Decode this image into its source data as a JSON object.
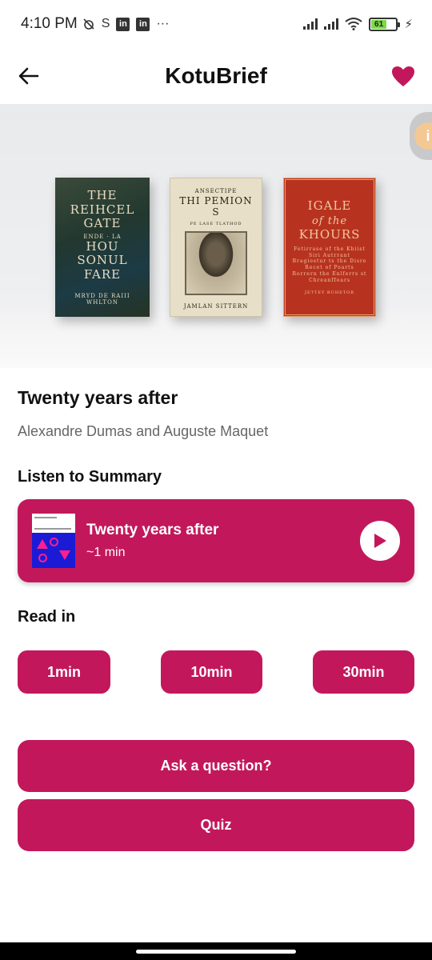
{
  "status_bar": {
    "time": "4:10 PM",
    "left_glyphs": [
      "alarm-off-icon",
      "s-icon"
    ],
    "linkedin_label": "in",
    "overflow": "···",
    "battery_percent": "61",
    "battery_level": 0.61
  },
  "app_bar": {
    "title": "KotuBrief",
    "back_icon": "arrow-left-icon",
    "favorite_icon": "heart-icon",
    "favorite_color": "#c2185b"
  },
  "hero": {
    "books": [
      {
        "title_lines": [
          "THE",
          "REIHCEL",
          "GATE"
        ],
        "sub": "ENDE · LA",
        "title2": [
          "HOU SONUL",
          "FARE"
        ],
        "author": "MRYD DE RAIII WHLTON"
      },
      {
        "top": "ANSECTIPE",
        "title": "THI PEMION S",
        "sub": "PE LASE TLATHOD",
        "author": "JAMLAN SITTERN"
      },
      {
        "title_lines": [
          "IGALE",
          "of the",
          "KHOURS"
        ],
        "desc": "Fetirrase of the Khiist Siri Autrrant Bragiostur ts the Disre Recet of Poarts Rorrern the Enlferrs st Chreanffears",
        "author": "JETTEY BUHETOR"
      }
    ]
  },
  "book": {
    "title": "Twenty years after",
    "author": "Alexandre Dumas and Auguste Maquet"
  },
  "listen": {
    "heading": "Listen to Summary",
    "card_title": "Twenty years after",
    "duration": "~1 min",
    "play_icon": "play-icon"
  },
  "read_in": {
    "heading": "Read in",
    "options": [
      "1min",
      "10min",
      "30min"
    ]
  },
  "actions": {
    "ask": "Ask a question?",
    "quiz": "Quiz"
  },
  "colors": {
    "accent": "#c2185b"
  }
}
